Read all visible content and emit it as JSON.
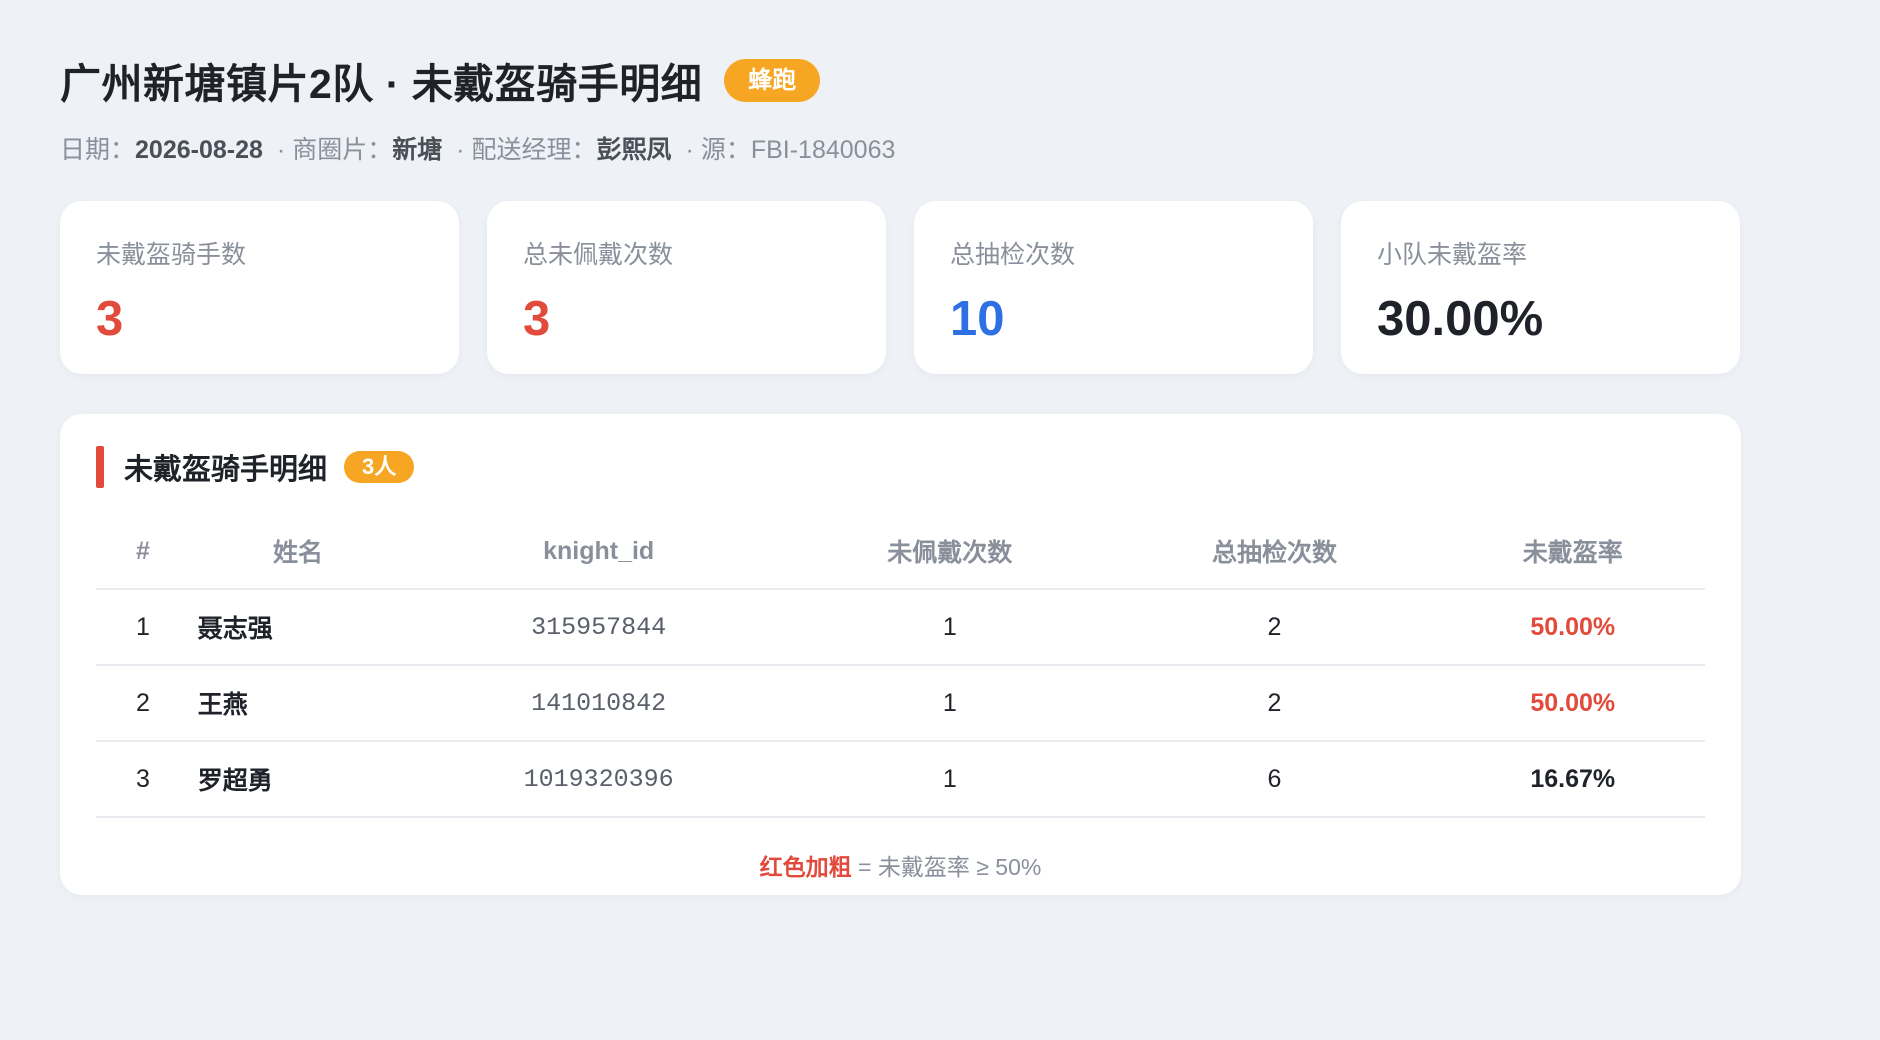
{
  "header": {
    "title": "广州新塘镇片2队 · 未戴盔骑手明细",
    "platform_badge": "蜂跑",
    "meta": {
      "date_label": "日期：",
      "date": "2026-08-28",
      "separator": "·",
      "area_label": "商圈片：",
      "area": "新塘",
      "manager_label": "配送经理：",
      "manager": "彭熙凤",
      "source_label": "源：",
      "source": "FBI-1840063"
    }
  },
  "kpis": [
    {
      "label": "未戴盔骑手数",
      "value": "3",
      "color": "#e24b3b"
    },
    {
      "label": "总未佩戴次数",
      "value": "3",
      "color": "#e24b3b"
    },
    {
      "label": "总抽检次数",
      "value": "10",
      "color": "#2f6fe4"
    },
    {
      "label": "小队未戴盔率",
      "value": "30.00%",
      "color": "#1f2329"
    }
  ],
  "detail": {
    "title": "未戴盔骑手明细",
    "count_badge": "3人",
    "columns": [
      "#",
      "姓名",
      "knight_id",
      "未佩戴次数",
      "总抽检次数",
      "未戴盔率"
    ],
    "rows": [
      {
        "index": "1",
        "name": "聂志强",
        "knight_id": "315957844",
        "no_helmet": "1",
        "checks": "2",
        "rate": "50.00%",
        "highlight": true
      },
      {
        "index": "2",
        "name": "王燕",
        "knight_id": "141010842",
        "no_helmet": "1",
        "checks": "2",
        "rate": "50.00%",
        "highlight": true
      },
      {
        "index": "3",
        "name": "罗超勇",
        "knight_id": "1019320396",
        "no_helmet": "1",
        "checks": "6",
        "rate": "16.67%",
        "highlight": false
      }
    ],
    "legend": {
      "key": "红色加粗",
      "text": " = 未戴盔率 ≥ 50%"
    }
  },
  "colors": {
    "accent_red": "#e24b3b",
    "accent_blue": "#2f6fe4",
    "badge_orange": "#f7a623",
    "background": "#eef1f6"
  }
}
